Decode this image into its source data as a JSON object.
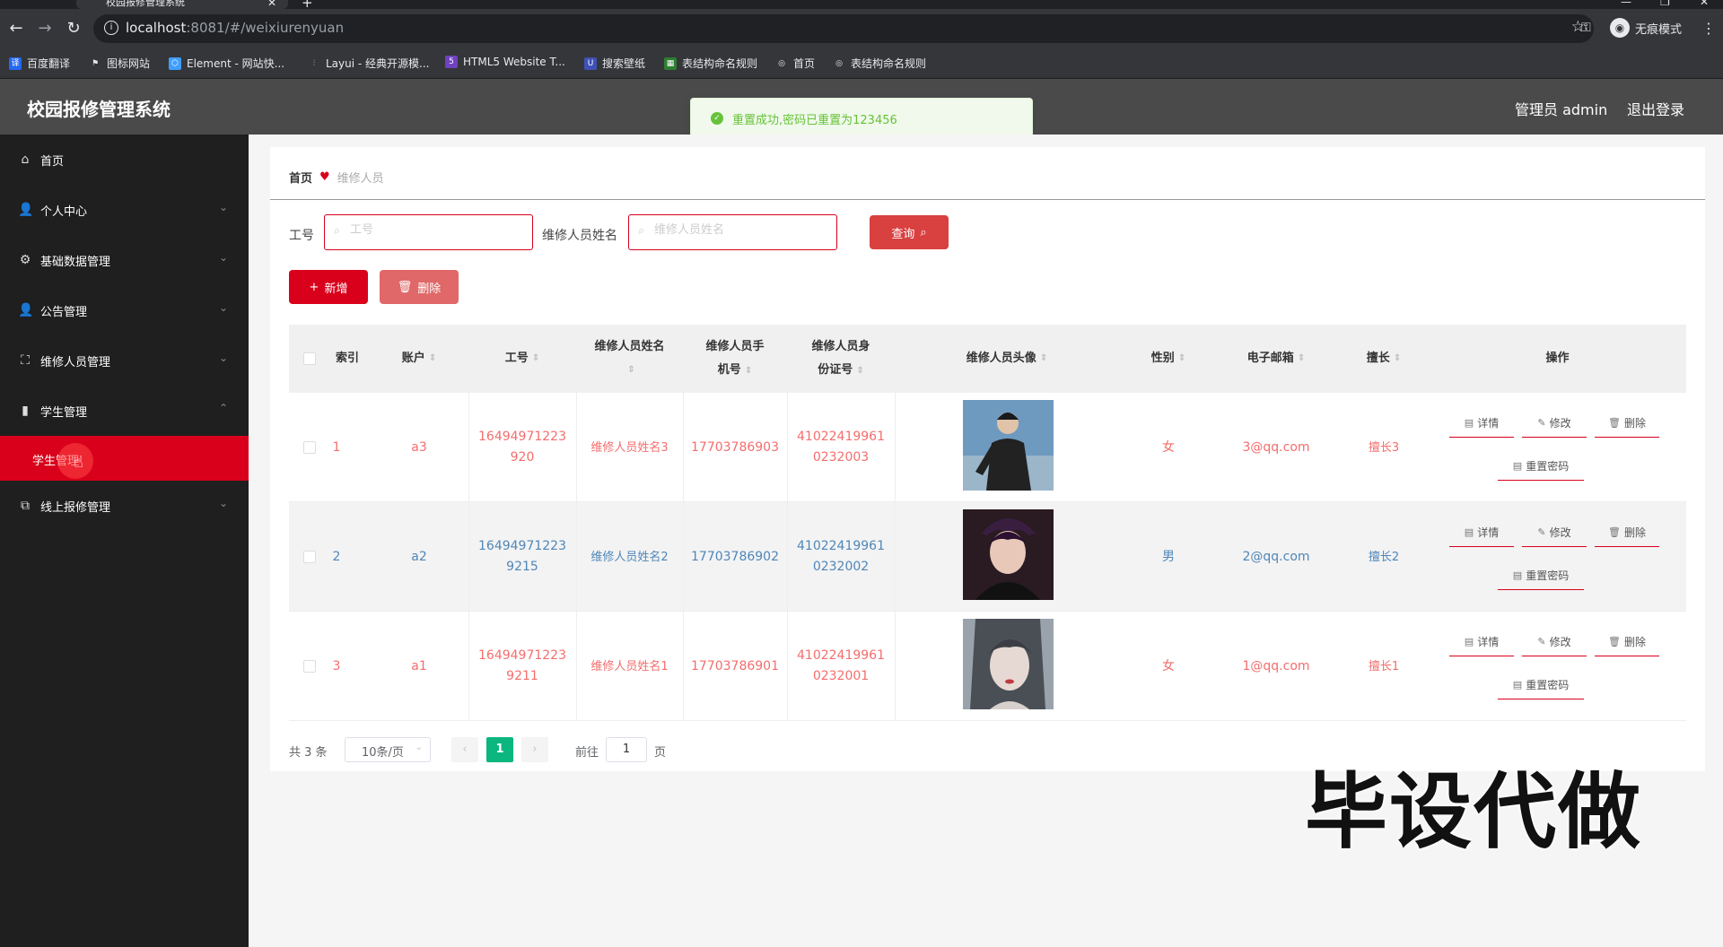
{
  "browser": {
    "tab_title": "校园报修管理系统",
    "url_host": "localhost",
    "url_path": ":8081/#/weixiurenyuan",
    "incognito_label": "无痕模式",
    "bookmarks": [
      {
        "label": "百度翻译",
        "icon": "baidu-translate-icon",
        "color": "#2468f2"
      },
      {
        "label": "图标网站",
        "icon": "flag-icon",
        "color": "#444444"
      },
      {
        "label": "Element - 网站快...",
        "icon": "element-icon",
        "color": "#409eff"
      },
      {
        "label": "Layui - 经典开源模...",
        "icon": "layui-icon",
        "color": "#444444"
      },
      {
        "label": "HTML5 Website T...",
        "icon": "html5-icon",
        "color": "#6f42c1"
      },
      {
        "label": "搜索壁纸",
        "icon": "wallpaper-icon",
        "color": "#3f51b5"
      },
      {
        "label": "表结构命名规则",
        "icon": "table-icon",
        "color": "#2e7d32"
      },
      {
        "label": "首页",
        "icon": "globe-icon",
        "color": "#444444"
      },
      {
        "label": "表结构命名规则",
        "icon": "globe-icon",
        "color": "#444444"
      }
    ]
  },
  "header": {
    "title": "校园报修管理系统",
    "admin_label": "管理员 admin",
    "logout_label": "退出登录"
  },
  "toast": {
    "message": "重置成功,密码已重置为123456",
    "color": "#67c23a"
  },
  "sidebar": {
    "items": [
      {
        "label": "首页",
        "icon": "home-icon",
        "has_children": false
      },
      {
        "label": "个人中心",
        "icon": "user-icon",
        "has_children": true
      },
      {
        "label": "基础数据管理",
        "icon": "settings-icon",
        "has_children": true
      },
      {
        "label": "公告管理",
        "icon": "user-icon",
        "has_children": true
      },
      {
        "label": "维修人员管理",
        "icon": "frame-icon",
        "has_children": true
      },
      {
        "label": "学生管理",
        "icon": "chart-icon",
        "has_children": true,
        "expanded": true
      },
      {
        "label": "线上报修管理",
        "icon": "copy-icon",
        "has_children": true
      }
    ],
    "sub_item": "学生管理",
    "active_color": "#d9001b"
  },
  "breadcrumb": {
    "home": "首页",
    "current": "维修人员"
  },
  "search": {
    "job_no_label": "工号",
    "job_no_placeholder": "工号",
    "name_label": "维修人员姓名",
    "name_placeholder": "维修人员姓名",
    "query_button": "查询"
  },
  "actions": {
    "add_label": "新增",
    "delete_label": "删除"
  },
  "table": {
    "columns": {
      "index": "索引",
      "account": "账户",
      "job_no": "工号",
      "name": "维修人员姓名",
      "phone": "维修人员手机号",
      "id_card": "维修人员身份证号",
      "photo": "维修人员头像",
      "gender": "性别",
      "email": "电子邮箱",
      "specialty": "擅长",
      "ops": "操作"
    },
    "ops_labels": {
      "detail": "详情",
      "edit": "修改",
      "delete": "删除",
      "reset": "重置密码"
    },
    "rows": [
      {
        "index": "1",
        "account": "a3",
        "job_no": "16494971223920",
        "name": "维修人员姓名3",
        "phone": "17703786903",
        "id_card": "410224199610232003",
        "gender": "女",
        "email": "3@qq.com",
        "specialty": "擅长3",
        "text_color": "#f46d6d"
      },
      {
        "index": "2",
        "account": "a2",
        "job_no": "16494971223 9215",
        "name": "维修人员姓名2",
        "phone": "17703786902",
        "id_card": "410224199610232002",
        "gender": "男",
        "email": "2@qq.com",
        "specialty": "擅长2",
        "text_color": "#4f86b8"
      },
      {
        "index": "3",
        "account": "a1",
        "job_no": "16494971223 9211",
        "name": "维修人员姓名1",
        "phone": "17703786901",
        "id_card": "410224199610232001",
        "gender": "女",
        "email": "1@qq.com",
        "specialty": "擅长1",
        "text_color": "#f46d6d"
      }
    ]
  },
  "pagination": {
    "total": "共 3 条",
    "page_size": "10条/页",
    "current_page": "1",
    "goto_label": "前往",
    "goto_value": "1",
    "page_unit": "页",
    "active_color": "#0bb67f"
  },
  "watermark": "毕设代做"
}
